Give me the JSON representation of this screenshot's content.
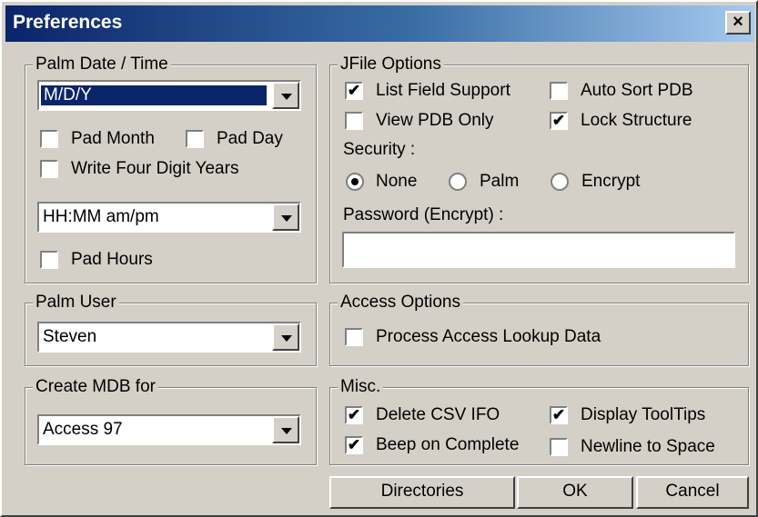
{
  "window": {
    "title": "Preferences",
    "close_icon": "×"
  },
  "palm_datetime": {
    "legend": "Palm Date / Time",
    "date_format": "M/D/Y",
    "pad_month": {
      "label": "Pad Month",
      "checked": false
    },
    "pad_day": {
      "label": "Pad Day",
      "checked": false
    },
    "four_digit_years": {
      "label": "Write Four Digit Years",
      "checked": false
    },
    "time_format": "HH:MM am/pm",
    "pad_hours": {
      "label": "Pad Hours",
      "checked": false
    }
  },
  "palm_user": {
    "legend": "Palm User",
    "value": "Steven"
  },
  "create_mdb": {
    "legend": "Create MDB for",
    "value": "Access 97"
  },
  "jfile_options": {
    "legend": "JFile Options",
    "list_field_support": {
      "label": "List Field Support",
      "checked": true
    },
    "auto_sort_pdb": {
      "label": "Auto Sort PDB",
      "checked": false
    },
    "view_pdb_only": {
      "label": "View PDB Only",
      "checked": false
    },
    "lock_structure": {
      "label": "Lock Structure",
      "checked": true
    },
    "security_label": "Security :",
    "security_options": [
      "None",
      "Palm",
      "Encrypt"
    ],
    "security_selected": "None",
    "password_label": "Password (Encrypt) :",
    "password_value": ""
  },
  "access_options": {
    "legend": "Access Options",
    "process_lookup": {
      "label": "Process Access Lookup Data",
      "checked": false
    }
  },
  "misc": {
    "legend": "Misc.",
    "delete_csv_ifo": {
      "label": "Delete CSV IFO",
      "checked": true
    },
    "display_tooltips": {
      "label": "Display ToolTips",
      "checked": true
    },
    "beep_on_complete": {
      "label": "Beep on Complete",
      "checked": true
    },
    "newline_to_space": {
      "label": "Newline to Space",
      "checked": false
    }
  },
  "buttons": {
    "directories": "Directories",
    "ok": "OK",
    "cancel": "Cancel"
  },
  "check_glyph": "✔"
}
